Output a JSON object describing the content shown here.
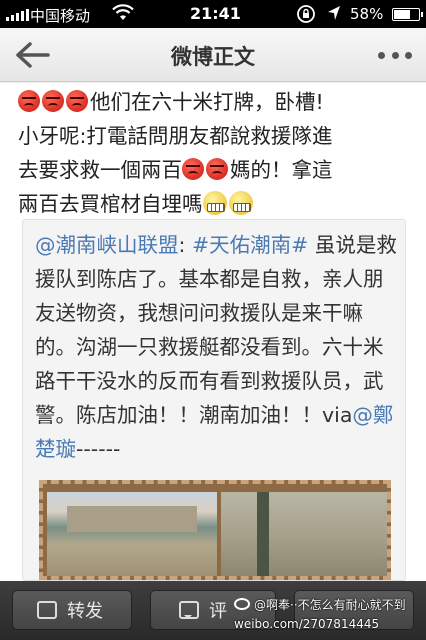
{
  "status_bar": {
    "carrier": "中国移动",
    "time": "21:41",
    "battery": "58%"
  },
  "nav": {
    "title": "微博正文"
  },
  "post": {
    "line1": "他们在六十米打牌，卧槽!",
    "line2": "小牙呢:打電話問朋友都說救援隊進",
    "line3a": "去要求救一個兩百",
    "line3b": "媽的！拿這",
    "line4": "兩百去買棺材自埋嗎"
  },
  "repost": {
    "mention1": "@潮南峡山联盟",
    "sep": ": ",
    "hashtag": "#天佑潮南#",
    "text": " 虽说是救援队到陈店了。基本都是自救，亲人朋友送物资，我想问问救援队是来干嘛的。沟湖一只救援艇都没看到。六十米路干干没水的反而有看到救援队员，武警。陈店加油！！潮南加油！！via",
    "mention2": "@鄭楚璇",
    "tail": "------"
  },
  "toolbar": {
    "repost_label": "转发",
    "comment_label": "评"
  },
  "watermark": {
    "line1": "@啊奉··不怎么有耐心就不到",
    "line2": "weibo.com/2707814445"
  }
}
